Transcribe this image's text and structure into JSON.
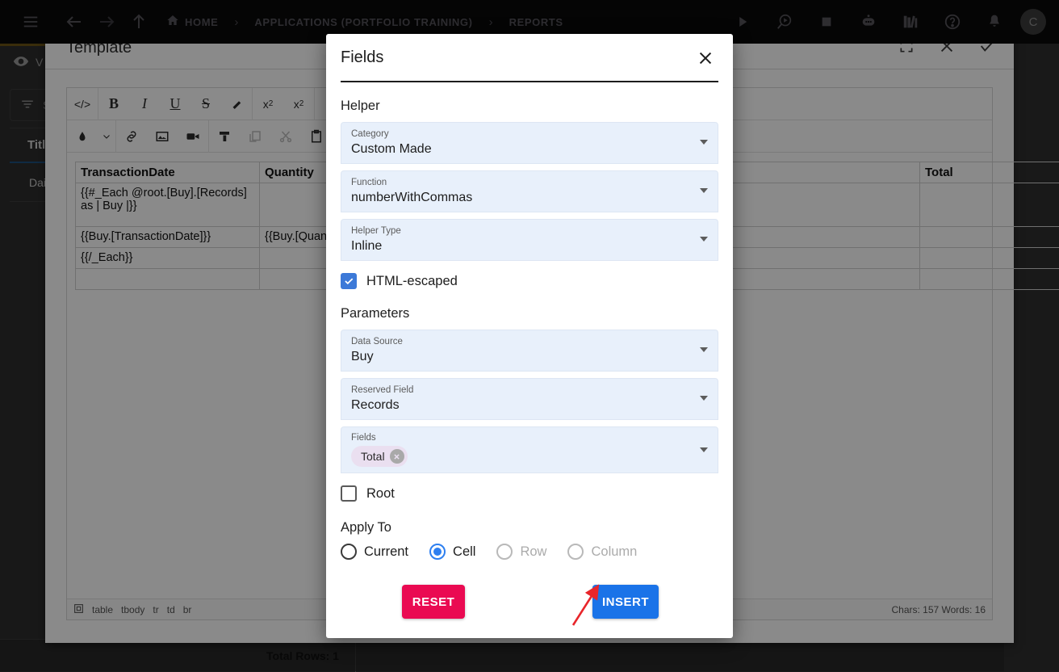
{
  "appbar": {
    "menu_icon": "hamburger-icon",
    "back_icon": "arrow-left-icon",
    "forward_icon": "arrow-right-icon",
    "up_icon": "arrow-up-icon",
    "home_icon": "home-icon",
    "breadcrumb": [
      {
        "label": "HOME"
      },
      {
        "label": "APPLICATIONS (PORTFOLIO TRAINING)"
      },
      {
        "label": "REPORTS"
      }
    ],
    "separator": "›",
    "right_icons": [
      "play-icon",
      "search-play-icon",
      "stop-icon",
      "chatbot-icon",
      "library-icon",
      "help-icon",
      "bell-icon"
    ],
    "avatar_initial": "C"
  },
  "left_panel": {
    "view_label": "V",
    "search_label": "S",
    "column_header": "Title",
    "row_value": "Daily",
    "total_rows": "Total Rows: 1"
  },
  "template": {
    "title": "Template",
    "actions": [
      {
        "name": "fullscreen-icon"
      },
      {
        "name": "close-icon"
      },
      {
        "name": "confirm-icon"
      }
    ],
    "toolbar_row1": [
      {
        "name": "source-code-icon",
        "glyph": "</>"
      },
      {
        "name": "bold-icon",
        "glyph": "B"
      },
      {
        "name": "italic-icon",
        "glyph": "I"
      },
      {
        "name": "underline-icon",
        "glyph": "U"
      },
      {
        "name": "strikethrough-icon",
        "glyph": "S"
      },
      {
        "name": "clear-format-icon",
        "glyph": "▰"
      },
      {
        "name": "superscript-icon",
        "glyph": "x2"
      },
      {
        "name": "subscript-icon",
        "glyph": "x2"
      }
    ],
    "toolbar_row2": [
      {
        "name": "text-color-icon"
      },
      {
        "name": "color-chevron-icon"
      },
      {
        "name": "link-icon"
      },
      {
        "name": "image-icon"
      },
      {
        "name": "video-icon"
      },
      {
        "name": "format-painter-icon"
      },
      {
        "name": "copy-icon"
      },
      {
        "name": "cut-icon"
      },
      {
        "name": "paste-icon"
      }
    ],
    "table": {
      "headers": [
        "TransactionDate",
        "Quantity",
        "",
        "Total"
      ],
      "rows": [
        [
          "{{#_Each @root.[Buy].[Records] as | Buy |}}",
          "",
          "",
          ""
        ],
        [
          "{{Buy.[TransactionDate]}}",
          "{{Buy.[Quantity]}}",
          "",
          ""
        ],
        [
          "{{/_Each}}",
          "",
          "",
          ""
        ],
        [
          "",
          "",
          "",
          ""
        ]
      ]
    },
    "status_path": [
      "table",
      "tbody",
      "tr",
      "td",
      "br"
    ],
    "status_counts": "Chars: 157   Words: 16",
    "status_tree_icon": "element-path-icon"
  },
  "modal": {
    "title": "Fields",
    "close_icon": "close-icon",
    "helper_section": "Helper",
    "fields": {
      "category": {
        "label": "Category",
        "value": "Custom Made"
      },
      "function": {
        "label": "Function",
        "value": "numberWithCommas"
      },
      "helper_type": {
        "label": "Helper Type",
        "value": "Inline"
      }
    },
    "html_escaped": {
      "label": "HTML-escaped",
      "checked": true
    },
    "parameters_section": "Parameters",
    "parameters": {
      "data_source": {
        "label": "Data Source",
        "value": "Buy"
      },
      "reserved_field": {
        "label": "Reserved Field",
        "value": "Records"
      },
      "fields": {
        "label": "Fields",
        "chips": [
          "Total"
        ]
      }
    },
    "root": {
      "label": "Root",
      "checked": false
    },
    "apply_to_section": "Apply To",
    "apply_to_options": [
      {
        "label": "Current",
        "selected": false,
        "disabled": false
      },
      {
        "label": "Cell",
        "selected": true,
        "disabled": false
      },
      {
        "label": "Row",
        "selected": false,
        "disabled": true
      },
      {
        "label": "Column",
        "selected": false,
        "disabled": true
      }
    ],
    "reset_label": "RESET",
    "insert_label": "INSERT"
  },
  "colors": {
    "accent_blue": "#1a73e8",
    "reset_pink": "#ea0a52",
    "field_bg": "#e8f0fb",
    "chip_bg": "#eadff0",
    "annotation_red": "#e8252a"
  }
}
